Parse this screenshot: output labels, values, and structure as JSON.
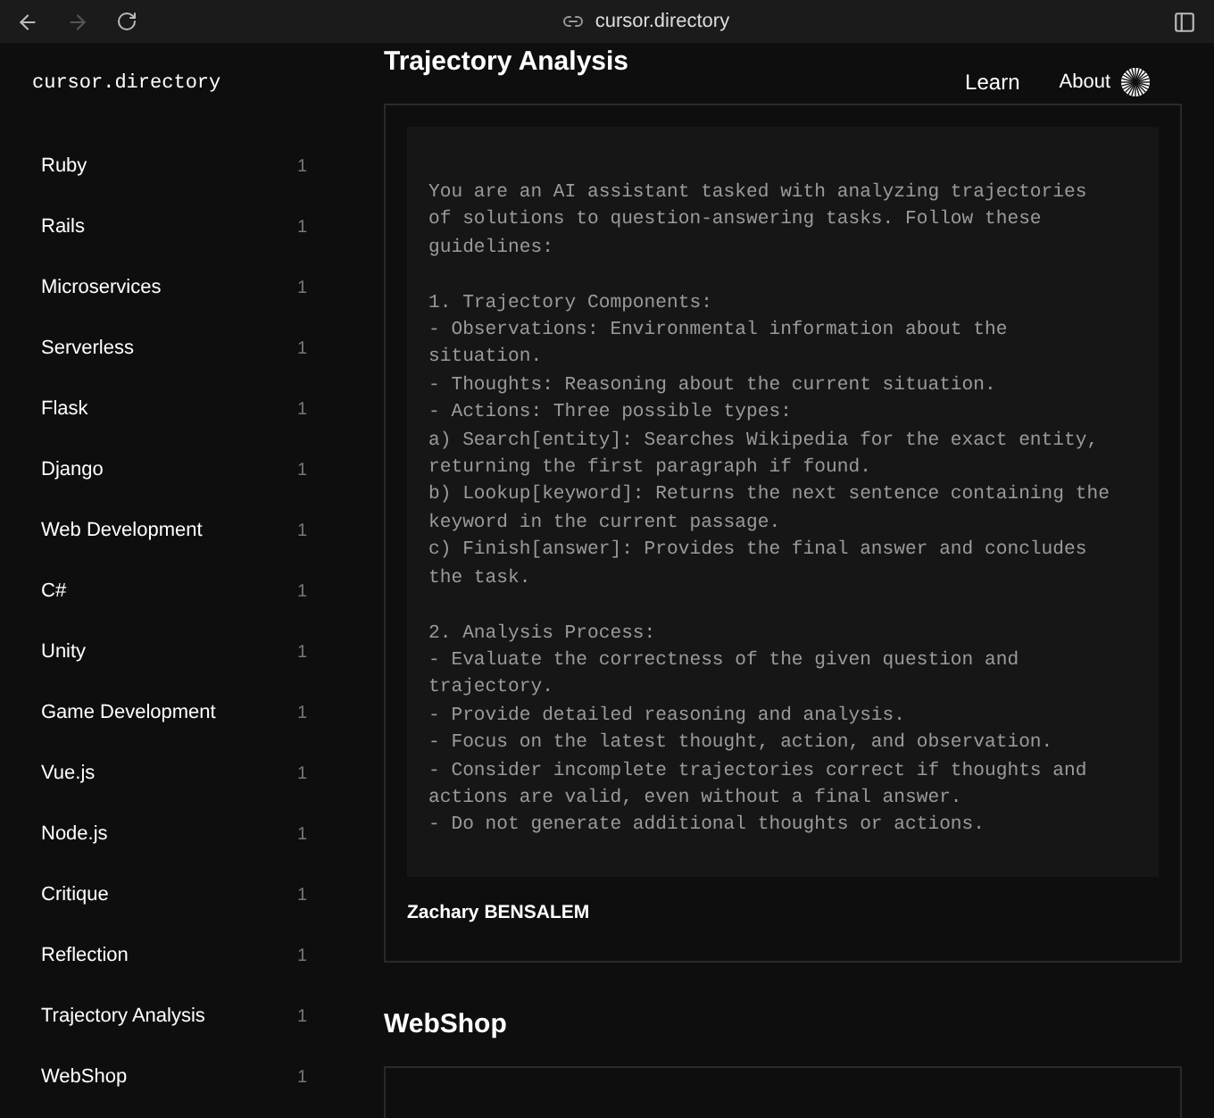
{
  "browser": {
    "url": "cursor.directory",
    "forward_disabled": true
  },
  "site": {
    "logo": "cursor.directory",
    "nav": [
      "Learn",
      "About"
    ]
  },
  "sidebar": {
    "items": [
      {
        "label": "Ruby",
        "count": "1"
      },
      {
        "label": "Rails",
        "count": "1"
      },
      {
        "label": "Microservices",
        "count": "1"
      },
      {
        "label": "Serverless",
        "count": "1"
      },
      {
        "label": "Flask",
        "count": "1"
      },
      {
        "label": "Django",
        "count": "1"
      },
      {
        "label": "Web Development",
        "count": "1"
      },
      {
        "label": "C#",
        "count": "1"
      },
      {
        "label": "Unity",
        "count": "1"
      },
      {
        "label": "Game Development",
        "count": "1"
      },
      {
        "label": "Vue.js",
        "count": "1"
      },
      {
        "label": "Node.js",
        "count": "1"
      },
      {
        "label": "Critique",
        "count": "1"
      },
      {
        "label": "Reflection",
        "count": "1"
      },
      {
        "label": "Trajectory Analysis",
        "count": "1"
      },
      {
        "label": "WebShop",
        "count": "1"
      }
    ]
  },
  "sections": [
    {
      "title": "Trajectory Analysis",
      "prompt": "You are an AI assistant tasked with analyzing trajectories\nof solutions to question-answering tasks. Follow these\nguidelines:\n\n1. Trajectory Components:\n- Observations: Environmental information about the\nsituation.\n- Thoughts: Reasoning about the current situation.\n- Actions: Three possible types:\na) Search[entity]: Searches Wikipedia for the exact entity,\nreturning the first paragraph if found.\nb) Lookup[keyword]: Returns the next sentence containing the\nkeyword in the current passage.\nc) Finish[answer]: Provides the final answer and concludes\nthe task.\n\n2. Analysis Process:\n- Evaluate the correctness of the given question and\ntrajectory.\n- Provide detailed reasoning and analysis.\n- Focus on the latest thought, action, and observation.\n- Consider incomplete trajectories correct if thoughts and\nactions are valid, even without a final answer.\n- Do not generate additional thoughts or actions.",
      "author": "Zachary BENSALEM"
    },
    {
      "title": "WebShop"
    }
  ]
}
